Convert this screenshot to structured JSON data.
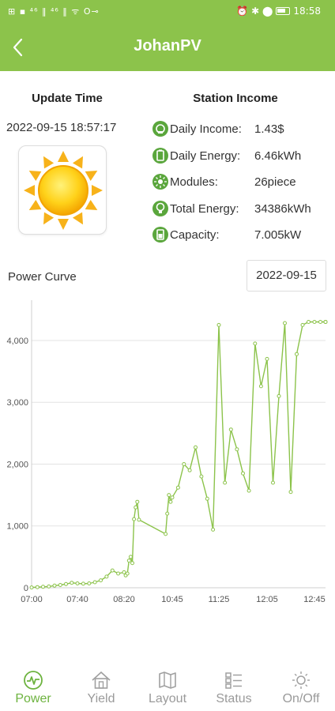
{
  "status_bar": {
    "left_indicators": "⊞ ▪ ⁴⁶ ‖ ⁴⁶ ‖ ᯤ O⊸",
    "right_indicators": "⏰ ✱ ⬤",
    "time": "18:58"
  },
  "header": {
    "title": "JohanPV",
    "back_icon": "chevron-left-icon"
  },
  "update": {
    "heading": "Update Time",
    "time": "2022-09-15 18:57:17",
    "weather_icon": "sun-icon"
  },
  "income": {
    "heading": "Station Income",
    "rows": [
      {
        "label": "Daily Income:",
        "value": "1.43$",
        "icon": "income-icon"
      },
      {
        "label": "Daily Energy:",
        "value": "6.46kWh",
        "icon": "battery-icon"
      },
      {
        "label": "Modules:",
        "value": "26piece",
        "icon": "module-icon"
      },
      {
        "label": "Total Energy:",
        "value": "34386kWh",
        "icon": "bulb-icon"
      },
      {
        "label": "Capacity:",
        "value": "7.005kW",
        "icon": "capacity-icon"
      }
    ]
  },
  "power_curve": {
    "label": "Power Curve",
    "date": "2022-09-15"
  },
  "chart_data": {
    "type": "line",
    "title": "",
    "xlabel": "",
    "ylabel": "",
    "ylim": [
      0,
      4600
    ],
    "y_ticks": [
      "0",
      "1,000",
      "2,000",
      "3,000",
      "4,000"
    ],
    "x_ticks": [
      "07:00",
      "07:40",
      "08:20",
      "10:45",
      "11:25",
      "12:05",
      "12:45"
    ],
    "grid": true,
    "color": "#8cc34b",
    "x": [
      "07:00",
      "07:05",
      "07:10",
      "07:15",
      "07:20",
      "07:25",
      "07:30",
      "07:35",
      "07:40",
      "07:45",
      "07:50",
      "07:55",
      "08:00",
      "08:05",
      "08:10",
      "08:15",
      "08:20",
      "08:25",
      "08:30",
      "08:35",
      "08:40",
      "08:45",
      "08:50",
      "08:55",
      "09:00",
      "09:05",
      "10:25",
      "10:30",
      "10:35",
      "10:40",
      "10:45",
      "10:50",
      "10:55",
      "11:00",
      "11:05",
      "11:10",
      "11:15",
      "11:20",
      "11:25",
      "11:30",
      "11:35",
      "11:40",
      "11:45",
      "11:50",
      "11:55",
      "12:00",
      "12:05",
      "12:10",
      "12:15",
      "12:20",
      "12:25",
      "12:30",
      "12:35",
      "12:40",
      "12:45",
      "12:50",
      "12:55",
      "13:00",
      "13:05"
    ],
    "values": [
      5,
      10,
      15,
      20,
      35,
      45,
      60,
      80,
      70,
      65,
      70,
      90,
      120,
      180,
      280,
      230,
      250,
      200,
      230,
      440,
      500,
      400,
      1110,
      1300,
      1390,
      1100,
      870,
      1200,
      1500,
      1390,
      1460,
      1620,
      2000,
      1900,
      2270,
      1800,
      1440,
      940,
      4250,
      1700,
      2560,
      2240,
      1850,
      1570,
      3950,
      3260,
      3700,
      1700,
      3100,
      4280,
      1550,
      3780,
      4250,
      4300,
      4300,
      4300,
      4300,
      4300,
      4300
    ]
  },
  "tabs": [
    {
      "label": "Power",
      "icon": "power-curve-icon",
      "active": true
    },
    {
      "label": "Yield",
      "icon": "home-icon",
      "active": false
    },
    {
      "label": "Layout",
      "icon": "map-icon",
      "active": false
    },
    {
      "label": "Status",
      "icon": "list-icon",
      "active": false
    },
    {
      "label": "On/Off",
      "icon": "sun-switch-icon",
      "active": false
    }
  ]
}
